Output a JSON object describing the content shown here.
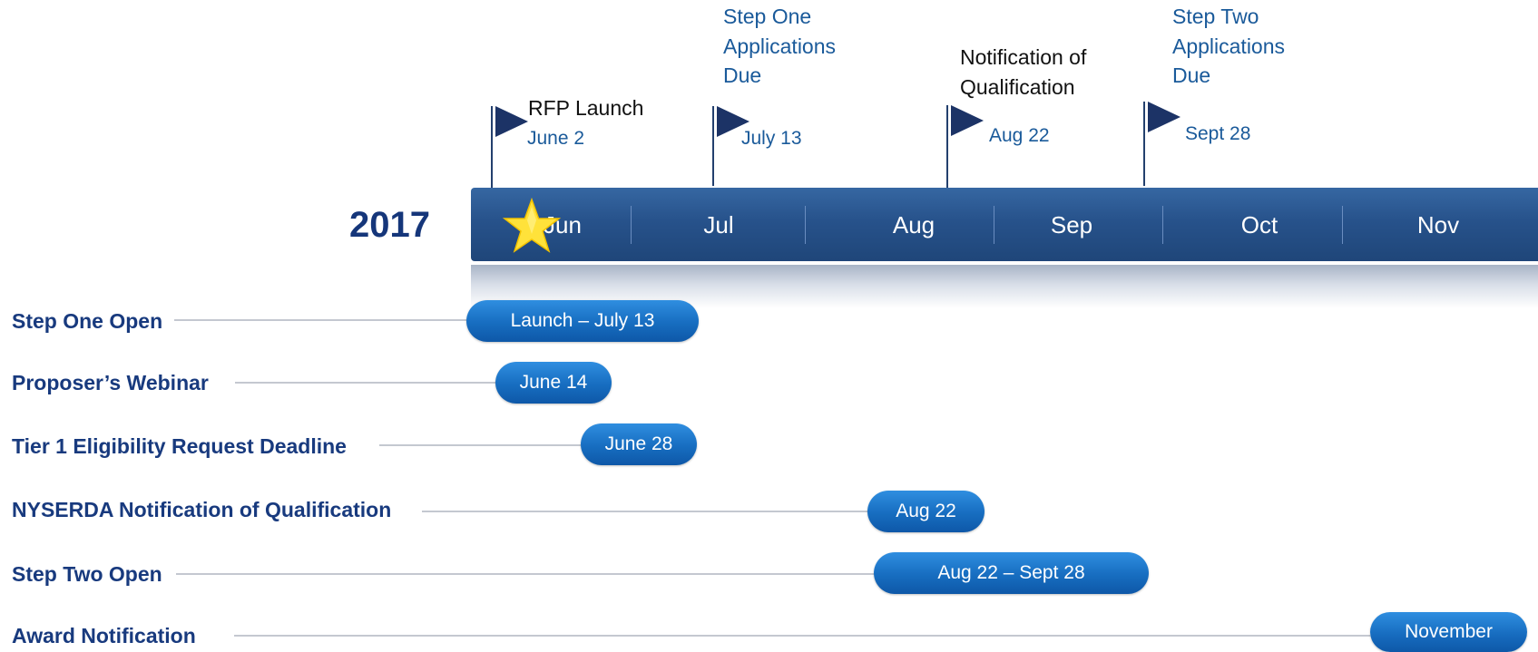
{
  "year": "2017",
  "milestones": [
    {
      "title": "RFP Launch",
      "date": "June 2"
    },
    {
      "title": "Step One\nApplications\nDue",
      "date": "July 13"
    },
    {
      "title": "Notification of\nQualification",
      "date": "Aug 22"
    },
    {
      "title": "Step Two\nApplications\nDue",
      "date": "Sept 28"
    }
  ],
  "months": [
    "Jun",
    "Jul",
    "Aug",
    "Sep",
    "Oct",
    "Nov"
  ],
  "rows": [
    {
      "label": "Step One Open",
      "pill": "Launch – July 13"
    },
    {
      "label": "Proposer’s Webinar",
      "pill": "June 14"
    },
    {
      "label": "Tier 1 Eligibility Request Deadline",
      "pill": "June 28"
    },
    {
      "label": "NYSERDA Notification of Qualification",
      "pill": "Aug 22"
    },
    {
      "label": "Step Two Open",
      "pill": "Aug 22 – Sept 28"
    },
    {
      "label": "Award Notification",
      "pill": "November"
    }
  ],
  "colors": {
    "band": "#27528b",
    "label": "#183a7e",
    "pill": "#176dc0",
    "star": "#ffe23a",
    "flag": "#1c3366"
  }
}
